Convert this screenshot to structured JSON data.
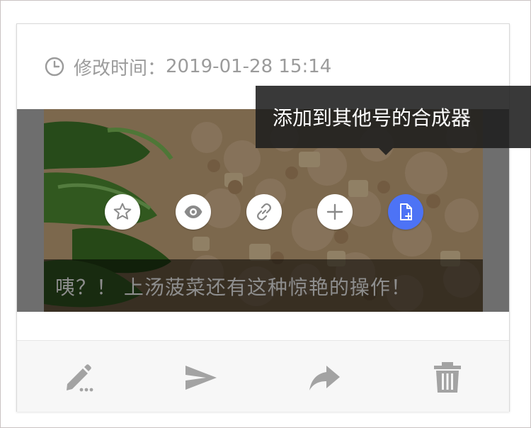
{
  "card": {
    "modified_label": "修改时间：",
    "modified_time": "2019-01-28 15:14",
    "title": "咦？！ 上汤菠菜还有这种惊艳的操作！",
    "tooltip": "添加到其他号的合成器"
  },
  "actions": [
    {
      "icon": "star-icon",
      "label": "favorite"
    },
    {
      "icon": "eye-icon",
      "label": "preview"
    },
    {
      "icon": "link-icon",
      "label": "copy-link"
    },
    {
      "icon": "plus-icon",
      "label": "add"
    },
    {
      "icon": "document-plus-icon",
      "label": "add-to-other-composer"
    }
  ],
  "footer": [
    {
      "icon": "edit-icon"
    },
    {
      "icon": "send-icon"
    },
    {
      "icon": "share-icon"
    },
    {
      "icon": "trash-icon"
    }
  ],
  "colors": {
    "accent": "#4d73f5",
    "muted": "#9b9b9b",
    "footer_bg": "#f7f7f7"
  }
}
